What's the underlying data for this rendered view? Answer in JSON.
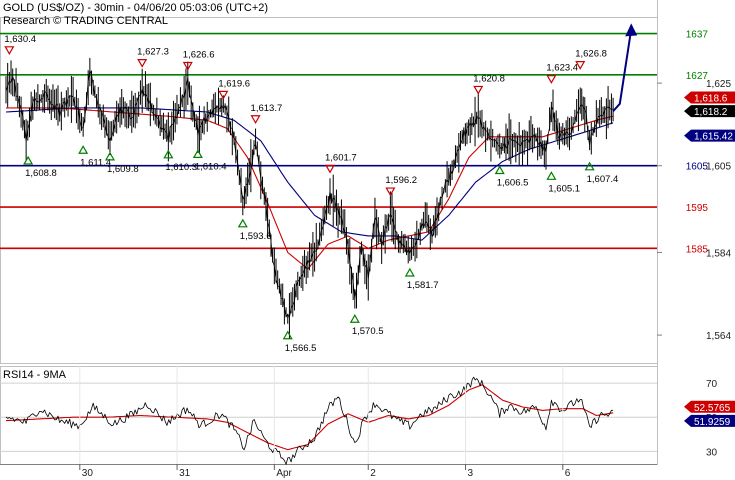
{
  "header": {
    "title": "GOLD (US$/OZ) - 30min - 04/06/20 05:03:06 (UTC+2)",
    "subtitle": "Research © TRADING CENTRAL"
  },
  "colors": {
    "price": "#000000",
    "ma_fast": "#cc0000",
    "ma_slow": "#000080",
    "resistance": "#cc0000",
    "support": "#000080",
    "target": "#008000",
    "projection": "#000080",
    "rsi": "#000000",
    "rsi_ma": "#cc0000",
    "tag_current": "#cc0000",
    "tag_pivot": "#000080"
  },
  "chart_data": [
    {
      "type": "line",
      "name": "price-panel",
      "x_ticks": [
        "30",
        "31",
        "Apr",
        "2",
        "3",
        "6"
      ],
      "y_ticks": [
        "1,625",
        "1,605",
        "1,584",
        "1,564"
      ],
      "ylim": [
        1557,
        1641
      ],
      "levels": [
        {
          "value": 1637,
          "label": "1637",
          "kind": "target"
        },
        {
          "value": 1627,
          "label": "1627",
          "kind": "target"
        },
        {
          "value": 1605,
          "label": "1605",
          "kind": "support"
        },
        {
          "value": 1595,
          "label": "1595",
          "kind": "resistance"
        },
        {
          "value": 1585,
          "label": "1585",
          "kind": "resistance"
        }
      ],
      "price_tags": [
        {
          "label": "1,618.6",
          "value": 1618.6,
          "kind": "current"
        },
        {
          "label": "1,618.2",
          "value": 1618.2,
          "kind": "last"
        },
        {
          "label": "1,615.42",
          "value": 1615.42,
          "kind": "pivot"
        }
      ],
      "swing_points": [
        {
          "type": "high",
          "x": 0.5,
          "label": "1,630.4",
          "value": 1630.4
        },
        {
          "type": "low",
          "x": 3.3,
          "label": "1,608.8",
          "value": 1608.8
        },
        {
          "type": "low",
          "x": 11.5,
          "label": "1,611.4",
          "value": 1611.4
        },
        {
          "type": "low",
          "x": 15.5,
          "label": "1,609.8",
          "value": 1609.8
        },
        {
          "type": "high",
          "x": 20.3,
          "label": "1,627.3",
          "value": 1627.3
        },
        {
          "type": "low",
          "x": 24.2,
          "label": "1,610.3",
          "value": 1610.3
        },
        {
          "type": "high",
          "x": 27.1,
          "label": "1,626.6",
          "value": 1626.6
        },
        {
          "type": "low",
          "x": 28.6,
          "label": "1,610.4",
          "value": 1610.4
        },
        {
          "type": "high",
          "x": 32.4,
          "label": "1,619.6",
          "value": 1619.6
        },
        {
          "type": "high",
          "x": 37.2,
          "label": "1,613.7",
          "value": 1613.7
        },
        {
          "type": "low",
          "x": 35.3,
          "label": "1,593.6",
          "value": 1593.6
        },
        {
          "type": "low",
          "x": 42.0,
          "label": "1,566.5",
          "value": 1566.5
        },
        {
          "type": "high",
          "x": 48.3,
          "label": "1,601.7",
          "value": 1601.7
        },
        {
          "type": "low",
          "x": 52.0,
          "label": "1,570.5",
          "value": 1570.5
        },
        {
          "type": "high",
          "x": 57.3,
          "label": "1,596.2",
          "value": 1596.2
        },
        {
          "type": "low",
          "x": 60.2,
          "label": "1,581.7",
          "value": 1581.7
        },
        {
          "type": "high",
          "x": 70.4,
          "label": "1,620.8",
          "value": 1620.8
        },
        {
          "type": "low",
          "x": 73.6,
          "label": "1,606.5",
          "value": 1606.5
        },
        {
          "type": "high",
          "x": 81.3,
          "label": "1,623.4",
          "value": 1623.4
        },
        {
          "type": "low",
          "x": 81.3,
          "label": "1,605.1",
          "value": 1605.1
        },
        {
          "type": "high",
          "x": 85.6,
          "label": "1,626.8",
          "value": 1626.8
        },
        {
          "type": "low",
          "x": 87.0,
          "label": "1,607.4",
          "value": 1607.4
        }
      ],
      "close_keypoints": [
        [
          0,
          1624
        ],
        [
          1,
          1626
        ],
        [
          2,
          1620
        ],
        [
          3,
          1612
        ],
        [
          4,
          1620
        ],
        [
          6,
          1622
        ],
        [
          8,
          1618
        ],
        [
          10,
          1622
        ],
        [
          11.5,
          1614
        ],
        [
          12.5,
          1628
        ],
        [
          14,
          1618
        ],
        [
          15.5,
          1612
        ],
        [
          17,
          1619
        ],
        [
          19,
          1617
        ],
        [
          20.3,
          1624
        ],
        [
          22,
          1618
        ],
        [
          24.2,
          1612
        ],
        [
          26,
          1620
        ],
        [
          27.1,
          1625
        ],
        [
          28.6,
          1613
        ],
        [
          30,
          1617
        ],
        [
          32.4,
          1620
        ],
        [
          34,
          1612
        ],
        [
          35.3,
          1596
        ],
        [
          36.5,
          1605
        ],
        [
          37.2,
          1611
        ],
        [
          38.5,
          1598
        ],
        [
          40,
          1580
        ],
        [
          42,
          1568
        ],
        [
          43.5,
          1576
        ],
        [
          45,
          1582
        ],
        [
          46.5,
          1586
        ],
        [
          48.3,
          1598
        ],
        [
          49.5,
          1594
        ],
        [
          50.5,
          1590
        ],
        [
          52,
          1573
        ],
        [
          53,
          1585
        ],
        [
          54,
          1578
        ],
        [
          55,
          1592
        ],
        [
          56,
          1586
        ],
        [
          57.3,
          1594
        ],
        [
          58.5,
          1587
        ],
        [
          60.2,
          1584
        ],
        [
          61.5,
          1588
        ],
        [
          62.5,
          1592
        ],
        [
          63.5,
          1588
        ],
        [
          65,
          1598
        ],
        [
          66.5,
          1604
        ],
        [
          68,
          1612
        ],
        [
          70.4,
          1617
        ],
        [
          71.5,
          1613
        ],
        [
          73.6,
          1609
        ],
        [
          75,
          1611
        ],
        [
          77,
          1610
        ],
        [
          79,
          1612
        ],
        [
          80.5,
          1608
        ],
        [
          81.3,
          1619
        ],
        [
          82.5,
          1612
        ],
        [
          84,
          1613
        ],
        [
          85.6,
          1620
        ],
        [
          86.5,
          1617
        ],
        [
          87,
          1610
        ],
        [
          88,
          1616
        ],
        [
          89.5,
          1618
        ],
        [
          90.5,
          1618.2
        ]
      ],
      "ma_fast_keypoints": [
        [
          0,
          1619
        ],
        [
          8,
          1619
        ],
        [
          16,
          1618
        ],
        [
          24,
          1617
        ],
        [
          30,
          1616
        ],
        [
          33,
          1614
        ],
        [
          36,
          1607
        ],
        [
          39,
          1596
        ],
        [
          42,
          1584
        ],
        [
          45,
          1580
        ],
        [
          48,
          1586
        ],
        [
          51,
          1588
        ],
        [
          54,
          1585
        ],
        [
          57,
          1587
        ],
        [
          60,
          1588
        ],
        [
          63,
          1589
        ],
        [
          66,
          1597
        ],
        [
          69,
          1607
        ],
        [
          72,
          1612
        ],
        [
          76,
          1612
        ],
        [
          80,
          1612
        ],
        [
          84,
          1614
        ],
        [
          88,
          1616
        ],
        [
          90.5,
          1617
        ]
      ],
      "ma_slow_keypoints": [
        [
          0,
          1618
        ],
        [
          10,
          1619
        ],
        [
          20,
          1619
        ],
        [
          30,
          1618
        ],
        [
          34,
          1616
        ],
        [
          38,
          1611
        ],
        [
          42,
          1601
        ],
        [
          46,
          1593
        ],
        [
          50,
          1589
        ],
        [
          54,
          1588
        ],
        [
          58,
          1588
        ],
        [
          62,
          1587
        ],
        [
          66,
          1593
        ],
        [
          70,
          1601
        ],
        [
          74,
          1606
        ],
        [
          78,
          1609
        ],
        [
          82,
          1611
        ],
        [
          86,
          1613
        ],
        [
          90.5,
          1615.4
        ]
      ],
      "projection": [
        [
          90.5,
          1618.2
        ],
        [
          91.5,
          1620
        ],
        [
          93.2,
          1638
        ]
      ]
    },
    {
      "type": "line",
      "name": "rsi-panel",
      "title": "RSI14 - 9MA",
      "y_ticks": [
        "70",
        "50",
        "30"
      ],
      "ylim": [
        22,
        80
      ],
      "reference_lines": [
        70,
        50,
        30
      ],
      "value_tags": [
        {
          "label": "52.5765",
          "value": 52.5765,
          "kind": "ma"
        },
        {
          "label": "51.9259",
          "value": 51.9259,
          "kind": "rsi"
        }
      ],
      "rsi_keypoints": [
        [
          0,
          50
        ],
        [
          3,
          47
        ],
        [
          5,
          55
        ],
        [
          8,
          48
        ],
        [
          11,
          45
        ],
        [
          13,
          56
        ],
        [
          16,
          46
        ],
        [
          19,
          52
        ],
        [
          21,
          58
        ],
        [
          24,
          47
        ],
        [
          27,
          55
        ],
        [
          29,
          45
        ],
        [
          32,
          52
        ],
        [
          34,
          43
        ],
        [
          35.5,
          32
        ],
        [
          37,
          48
        ],
        [
          38.5,
          37
        ],
        [
          40,
          30
        ],
        [
          42,
          24
        ],
        [
          44,
          32
        ],
        [
          46,
          38
        ],
        [
          48,
          55
        ],
        [
          49.5,
          62
        ],
        [
          51,
          46
        ],
        [
          52,
          34
        ],
        [
          53.5,
          50
        ],
        [
          55,
          58
        ],
        [
          57,
          52
        ],
        [
          58.5,
          48
        ],
        [
          60.2,
          45
        ],
        [
          62,
          52
        ],
        [
          64,
          55
        ],
        [
          66,
          62
        ],
        [
          68,
          65
        ],
        [
          69.5,
          71
        ],
        [
          70.4,
          72
        ],
        [
          72,
          64
        ],
        [
          73.6,
          52
        ],
        [
          75,
          57
        ],
        [
          77,
          53
        ],
        [
          79,
          56
        ],
        [
          80.5,
          44
        ],
        [
          81.3,
          60
        ],
        [
          83,
          54
        ],
        [
          85.6,
          61
        ],
        [
          87,
          44
        ],
        [
          88.5,
          51
        ],
        [
          90.5,
          52
        ]
      ],
      "rsi_ma_keypoints": [
        [
          0,
          48
        ],
        [
          5,
          49
        ],
        [
          10,
          50
        ],
        [
          15,
          50
        ],
        [
          20,
          51
        ],
        [
          25,
          50
        ],
        [
          30,
          49
        ],
        [
          33,
          47
        ],
        [
          36,
          41
        ],
        [
          39,
          35
        ],
        [
          42,
          31
        ],
        [
          45,
          34
        ],
        [
          48,
          46
        ],
        [
          51,
          52
        ],
        [
          54,
          47
        ],
        [
          57,
          51
        ],
        [
          60,
          49
        ],
        [
          63,
          51
        ],
        [
          66,
          57
        ],
        [
          69,
          66
        ],
        [
          71,
          69
        ],
        [
          74,
          60
        ],
        [
          77,
          56
        ],
        [
          80,
          54
        ],
        [
          83,
          55
        ],
        [
          86,
          55
        ],
        [
          88,
          51
        ],
        [
          90.5,
          52.6
        ]
      ]
    }
  ]
}
